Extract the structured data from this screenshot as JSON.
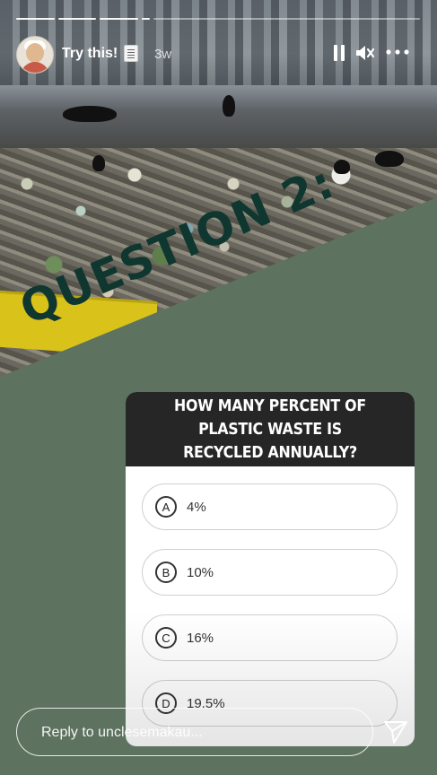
{
  "header": {
    "username": "Try this!",
    "emoji_icon": "notepad-icon",
    "time_ago": "3w",
    "pause_icon": "pause-icon",
    "mute_icon": "speaker-muted-icon",
    "more_icon": "more-horizontal-icon"
  },
  "question_label": "QUESTION 2:",
  "quiz": {
    "question": "HOW MANY PERCENT OF PLASTIC WASTE IS RECYCLED ANNUALLY?",
    "options": [
      {
        "letter": "A",
        "value": "4%"
      },
      {
        "letter": "B",
        "value": "10%"
      },
      {
        "letter": "C",
        "value": "16%"
      },
      {
        "letter": "D",
        "value": "19.5%"
      }
    ]
  },
  "reply": {
    "placeholder": "Reply to unclesemakau..."
  },
  "send_icon": "send-icon",
  "colors": {
    "panel_green": "#5e7260",
    "question_label": "#0f3730",
    "card_header": "#262626"
  }
}
